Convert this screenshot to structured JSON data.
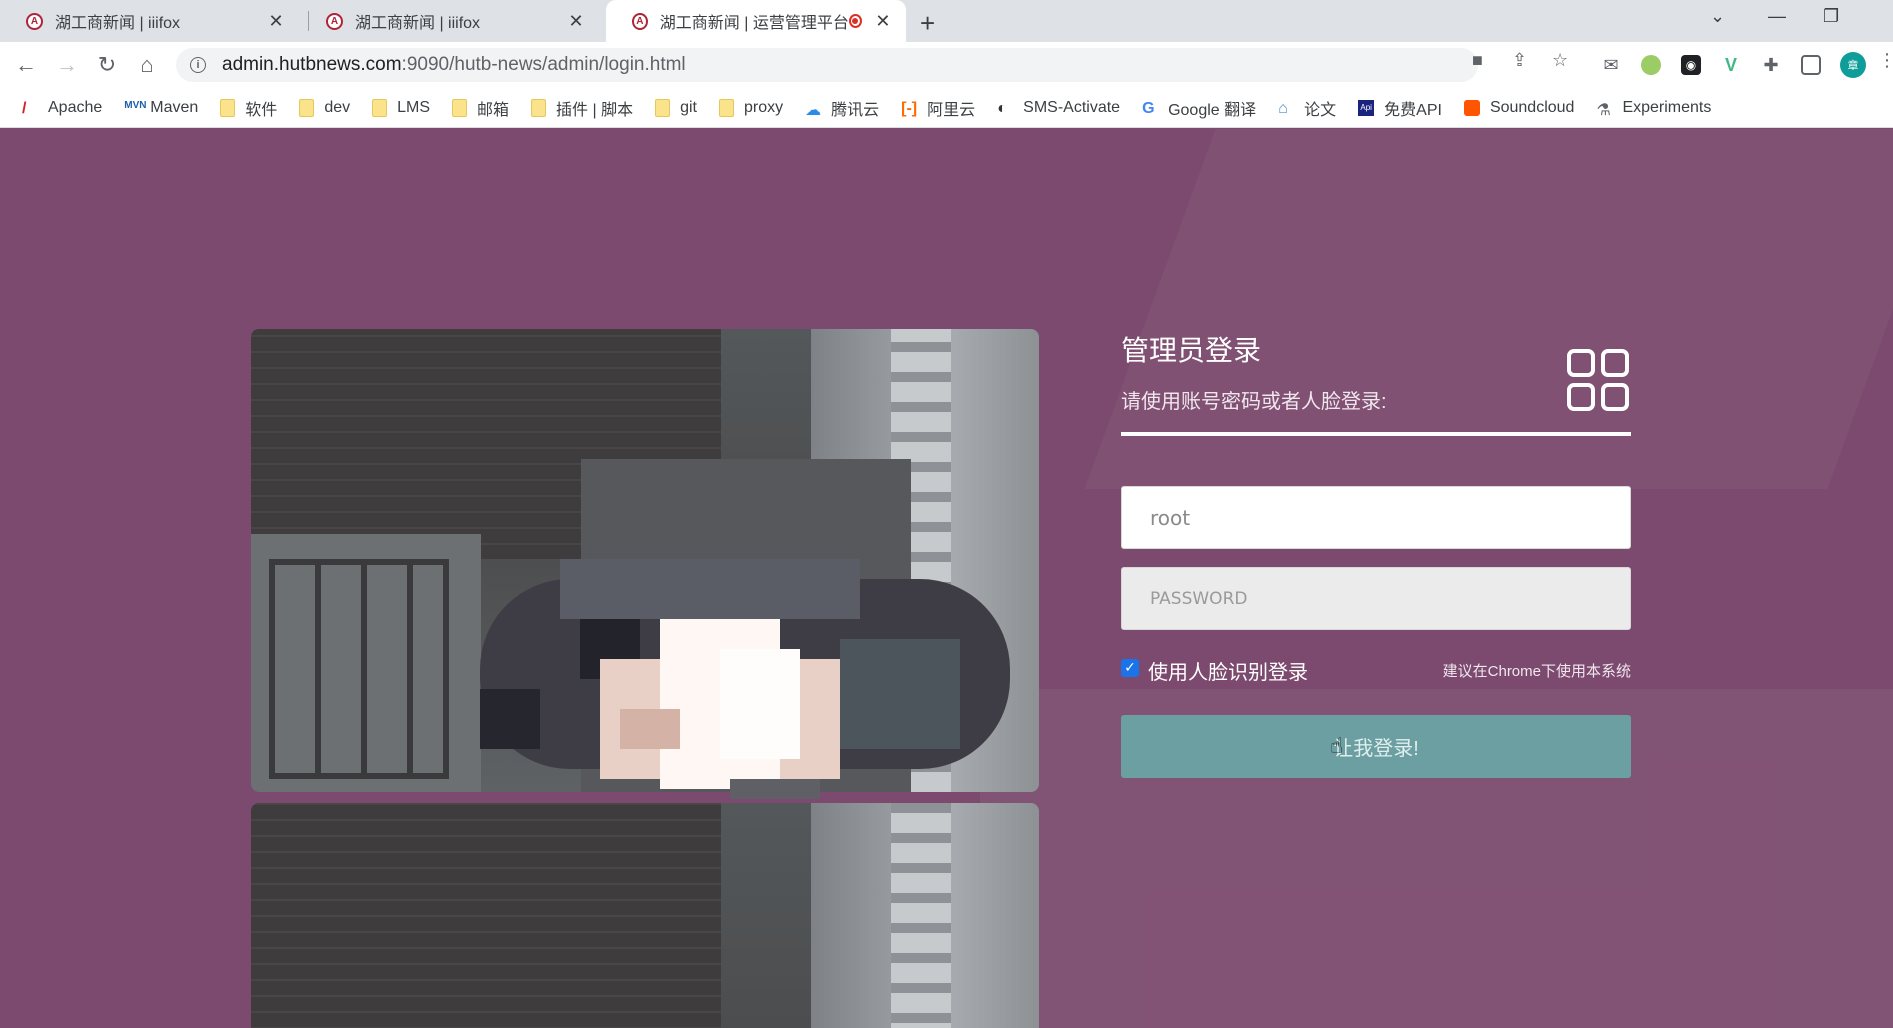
{
  "tabs": [
    {
      "title": "湖工商新闻 | iiifox",
      "active": false
    },
    {
      "title": "湖工商新闻 | iiifox",
      "active": false
    },
    {
      "title": "湖工商新闻 | 运营管理平台",
      "active": true
    }
  ],
  "address": {
    "host": "admin.hutbnews.com",
    "path": ":9090/hutb-news/admin/login.html"
  },
  "profile_initial": "章",
  "bookmarks": [
    "Apache",
    "Maven",
    "软件",
    "dev",
    "LMS",
    "邮箱",
    "插件 | 脚本",
    "git",
    "proxy",
    "腾讯云",
    "阿里云",
    "SMS-Activate",
    "Google 翻译",
    "论文",
    "免费API",
    "Soundcloud",
    "Experiments"
  ],
  "login": {
    "title": "管理员登录",
    "subtitle": "请使用账号密码或者人脸登录:",
    "username_value": "root",
    "password_placeholder": "PASSWORD",
    "face_login_label": "使用人脸识别登录",
    "face_login_checked": true,
    "browser_hint": "建议在Chrome下使用本系统",
    "submit_label": "让我登录!"
  },
  "colors": {
    "page_bg": "#7b4a6e",
    "submit_bg": "#6c9fa2",
    "accent": "#ffffff"
  }
}
